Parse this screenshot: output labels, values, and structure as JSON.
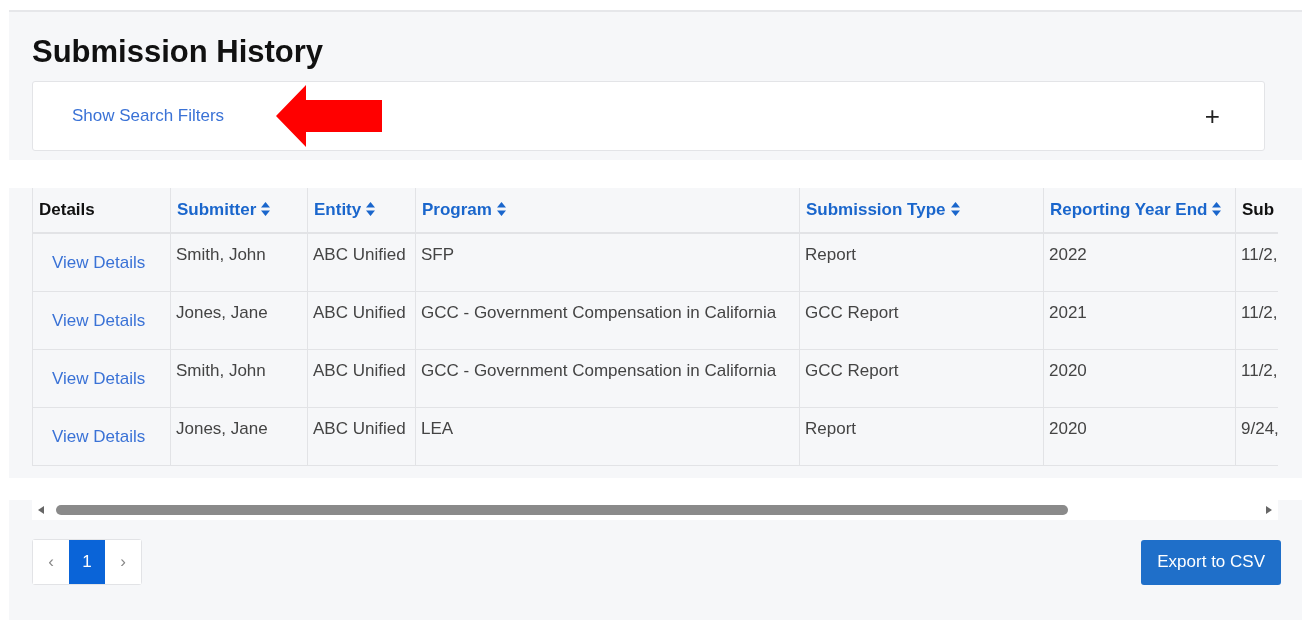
{
  "title": "Submission History",
  "filters": {
    "label": "Show Search Filters",
    "toggle": "+",
    "expanded": false
  },
  "table": {
    "columns": [
      {
        "label": "Details",
        "sortable": false
      },
      {
        "label": "Submitter",
        "sortable": true
      },
      {
        "label": "Entity",
        "sortable": true
      },
      {
        "label": "Program",
        "sortable": true
      },
      {
        "label": "Submission Type",
        "sortable": true
      },
      {
        "label": "Reporting Year End",
        "sortable": true
      },
      {
        "label": "Sub",
        "sortable": false
      }
    ],
    "rows": [
      {
        "details": "View Details",
        "submitter": "Smith, John",
        "entity": "ABC Unified",
        "program": "SFP",
        "type": "Report",
        "year": "2022",
        "column_7": "11/2,"
      },
      {
        "details": "View Details",
        "submitter": "Jones, Jane",
        "entity": "ABC Unified",
        "program": "GCC - Government Compensation in California",
        "type": "GCC Report",
        "year": "2021",
        "column_7": "11/2,"
      },
      {
        "details": "View Details",
        "submitter": "Smith, John",
        "entity": "ABC Unified",
        "program": "GCC - Government Compensation in California",
        "type": "GCC Report",
        "year": "2020",
        "column_7": "11/2,"
      },
      {
        "details": "View Details",
        "submitter": "Jones, Jane",
        "entity": "ABC Unified",
        "program": "LEA",
        "type": "Report",
        "year": "2020",
        "column_7": "9/24,"
      }
    ]
  },
  "pagination": {
    "prev": "‹",
    "pages": [
      {
        "label": "1",
        "selected": true
      }
    ],
    "next": "›"
  },
  "export_button": "Export to CSV"
}
